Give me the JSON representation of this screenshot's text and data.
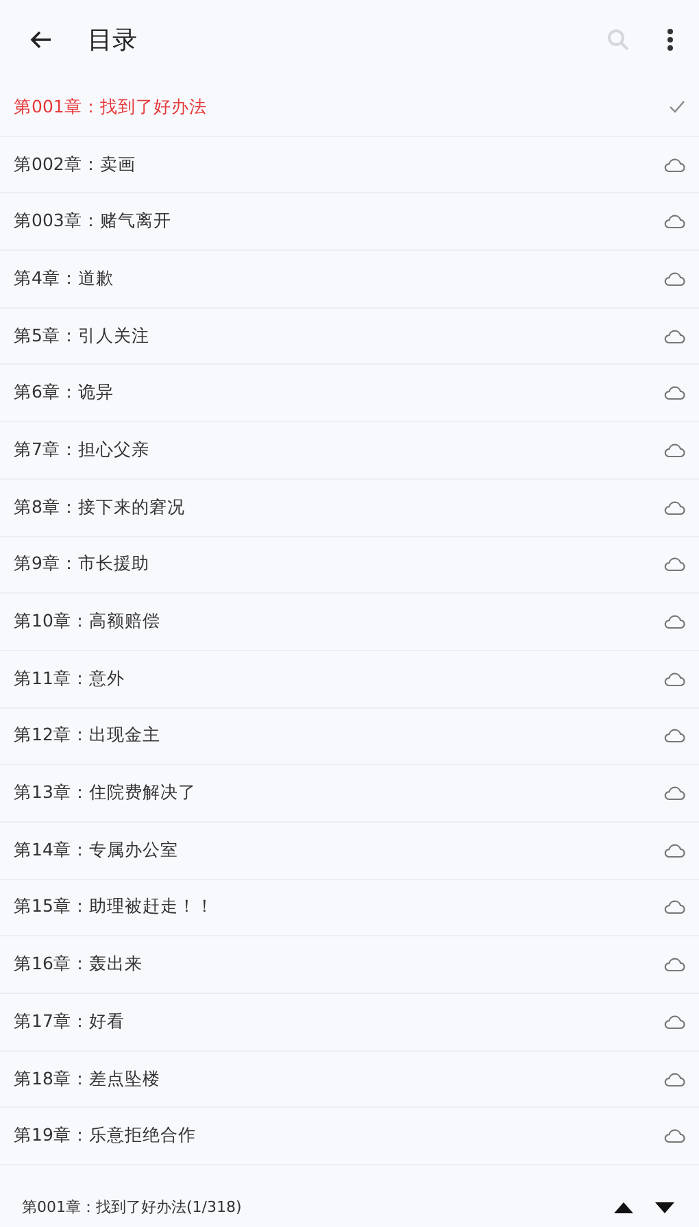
{
  "app_bar": {
    "title": "目录"
  },
  "chapters": [
    {
      "title": "第001章：找到了好办法",
      "selected": true
    },
    {
      "title": "第002章：卖画",
      "selected": false
    },
    {
      "title": "第003章：赌气离开",
      "selected": false
    },
    {
      "title": "第4章：道歉",
      "selected": false
    },
    {
      "title": "第5章：引人关注",
      "selected": false
    },
    {
      "title": "第6章：诡异",
      "selected": false
    },
    {
      "title": "第7章：担心父亲",
      "selected": false
    },
    {
      "title": "第8章：接下来的窘况",
      "selected": false
    },
    {
      "title": "第9章：市长援助",
      "selected": false
    },
    {
      "title": "第10章：高额赔偿",
      "selected": false
    },
    {
      "title": "第11章：意外",
      "selected": false
    },
    {
      "title": "第12章：出现金主",
      "selected": false
    },
    {
      "title": "第13章：住院费解决了",
      "selected": false
    },
    {
      "title": "第14章：专属办公室",
      "selected": false
    },
    {
      "title": "第15章：助理被赶走！！",
      "selected": false
    },
    {
      "title": "第16章：轰出来",
      "selected": false
    },
    {
      "title": "第17章：好看",
      "selected": false
    },
    {
      "title": "第18章：差点坠楼",
      "selected": false
    },
    {
      "title": "第19章：乐意拒绝合作",
      "selected": false
    }
  ],
  "bottom_bar": {
    "current": "第001章：找到了好办法(1/318)"
  }
}
